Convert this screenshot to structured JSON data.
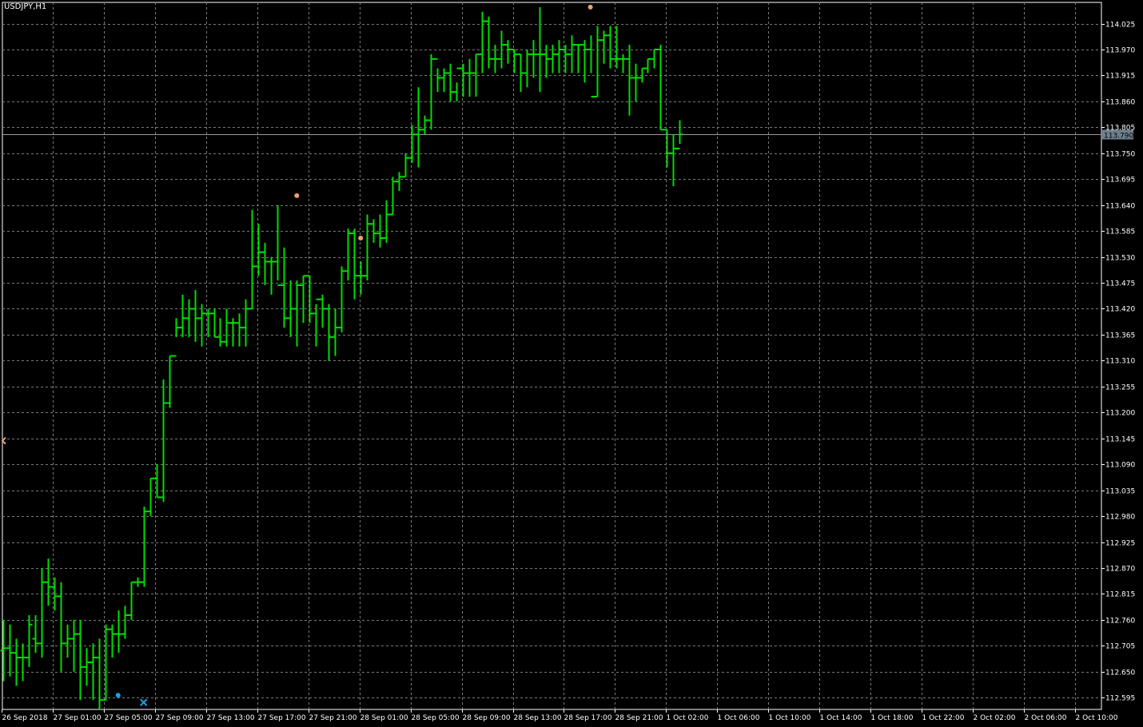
{
  "window": {
    "symbol_title": "USDJPY,H1"
  },
  "colors": {
    "background": "#000000",
    "grid": "#7a7a7a",
    "bars": "#00dd00",
    "text": "#ffffff",
    "current_price_box": "#6e7f8c",
    "dot_orange": "#f0a070",
    "dot_blue": "#1aa3e8"
  },
  "chart_data": {
    "type": "ohlc",
    "timeframe": "H1",
    "ylim": [
      112.57,
      114.07
    ],
    "grid": true,
    "current_price": {
      "value": 113.79,
      "label": "113.790"
    },
    "y_ticks": [
      "114.025",
      "113.970",
      "113.915",
      "113.860",
      "113.805",
      "113.750",
      "113.695",
      "113.640",
      "113.585",
      "113.530",
      "113.475",
      "113.420",
      "113.365",
      "113.310",
      "113.255",
      "113.200",
      "113.145",
      "113.090",
      "113.035",
      "112.980",
      "112.925",
      "112.870",
      "112.815",
      "112.760",
      "112.705",
      "112.650",
      "112.595"
    ],
    "x_ticks": [
      "26 Sep 2018",
      "27 Sep 01:00",
      "27 Sep 05:00",
      "27 Sep 09:00",
      "27 Sep 13:00",
      "27 Sep 17:00",
      "27 Sep 21:00",
      "28 Sep 01:00",
      "28 Sep 05:00",
      "28 Sep 09:00",
      "28 Sep 13:00",
      "28 Sep 17:00",
      "28 Sep 21:00",
      "1 Oct 02:00",
      "1 Oct 06:00",
      "1 Oct 10:00",
      "1 Oct 14:00",
      "1 Oct 18:00",
      "1 Oct 22:00",
      "2 Oct 02:00",
      "2 Oct 06:00",
      "2 Oct 10:00"
    ],
    "bars": [
      [
        112.695,
        112.76,
        112.63,
        112.7
      ],
      [
        112.7,
        112.75,
        112.64,
        112.69
      ],
      [
        112.69,
        112.72,
        112.62,
        112.68
      ],
      [
        112.68,
        112.71,
        112.63,
        112.68
      ],
      [
        112.68,
        112.77,
        112.66,
        112.75
      ],
      [
        112.72,
        112.77,
        112.69,
        112.71
      ],
      [
        112.71,
        112.87,
        112.68,
        112.84
      ],
      [
        112.84,
        112.89,
        112.79,
        112.83
      ],
      [
        112.83,
        112.85,
        112.78,
        112.81
      ],
      [
        112.81,
        112.84,
        112.65,
        112.71
      ],
      [
        112.71,
        112.75,
        112.68,
        112.72
      ],
      [
        112.72,
        112.76,
        112.65,
        112.73
      ],
      [
        112.73,
        112.76,
        112.59,
        112.66
      ],
      [
        112.66,
        112.7,
        112.62,
        112.67
      ],
      [
        112.67,
        112.71,
        112.59,
        112.68
      ],
      [
        112.68,
        112.72,
        112.57,
        112.59
      ],
      [
        112.59,
        112.75,
        112.59,
        112.74
      ],
      [
        112.74,
        112.75,
        112.68,
        112.73
      ],
      [
        112.73,
        112.78,
        112.69,
        112.73
      ],
      [
        112.73,
        112.79,
        112.72,
        112.77
      ],
      [
        112.77,
        112.84,
        112.76,
        112.84
      ],
      [
        112.84,
        112.85,
        112.83,
        112.84
      ],
      [
        112.84,
        113.0,
        112.83,
        112.99
      ],
      [
        112.99,
        113.06,
        112.98,
        113.06
      ],
      [
        113.06,
        113.09,
        113.02,
        113.02
      ],
      [
        113.02,
        113.27,
        113.01,
        113.22
      ],
      [
        113.22,
        113.32,
        113.21,
        113.32
      ],
      [
        113.32,
        113.4,
        113.36,
        113.38
      ],
      [
        113.38,
        113.45,
        113.36,
        113.4
      ],
      [
        113.4,
        113.44,
        113.36,
        113.42
      ],
      [
        113.42,
        113.46,
        113.35,
        113.4
      ],
      [
        113.4,
        113.43,
        113.34,
        113.41
      ],
      [
        113.41,
        113.42,
        113.36,
        113.41
      ],
      [
        113.41,
        113.42,
        113.36,
        113.36
      ],
      [
        113.36,
        113.4,
        113.34,
        113.35
      ],
      [
        113.35,
        113.42,
        113.34,
        113.39
      ],
      [
        113.39,
        113.4,
        113.34,
        113.39
      ],
      [
        113.39,
        113.41,
        113.34,
        113.38
      ],
      [
        113.38,
        113.44,
        113.34,
        113.42
      ],
      [
        113.42,
        113.63,
        113.42,
        113.51
      ],
      [
        113.51,
        113.6,
        113.49,
        113.54
      ],
      [
        113.54,
        113.56,
        113.47,
        113.52
      ],
      [
        113.52,
        113.53,
        113.45,
        113.52
      ],
      [
        113.52,
        113.64,
        113.48,
        113.47
      ],
      [
        113.47,
        113.55,
        113.38,
        113.4
      ],
      [
        113.4,
        113.48,
        113.36,
        113.42
      ],
      [
        113.42,
        113.48,
        113.34,
        113.47
      ],
      [
        113.47,
        113.49,
        113.39,
        113.49
      ],
      [
        113.49,
        113.49,
        113.39,
        113.41
      ],
      [
        113.41,
        113.43,
        113.34,
        113.44
      ],
      [
        113.44,
        113.45,
        113.38,
        113.42
      ],
      [
        113.42,
        113.43,
        113.31,
        113.36
      ],
      [
        113.36,
        113.42,
        113.32,
        113.38
      ],
      [
        113.38,
        113.51,
        113.37,
        113.5
      ],
      [
        113.5,
        113.59,
        113.48,
        113.58
      ],
      [
        113.58,
        113.59,
        113.44,
        113.49
      ],
      [
        113.49,
        113.52,
        113.45,
        113.49
      ],
      [
        113.49,
        113.62,
        113.48,
        113.6
      ],
      [
        113.6,
        113.61,
        113.56,
        113.58
      ],
      [
        113.58,
        113.62,
        113.55,
        113.57
      ],
      [
        113.57,
        113.65,
        113.56,
        113.62
      ],
      [
        113.62,
        113.7,
        113.62,
        113.69
      ],
      [
        113.69,
        113.71,
        113.67,
        113.7
      ],
      [
        113.7,
        113.75,
        113.7,
        113.74
      ],
      [
        113.74,
        113.81,
        113.73,
        113.79
      ],
      [
        113.79,
        113.89,
        113.72,
        113.8
      ],
      [
        113.8,
        113.83,
        113.79,
        113.82
      ],
      [
        113.82,
        113.96,
        113.8,
        113.95
      ],
      [
        113.95,
        113.93,
        113.88,
        113.91
      ],
      [
        113.91,
        113.93,
        113.88,
        113.92
      ],
      [
        113.92,
        113.94,
        113.86,
        113.88
      ],
      [
        113.88,
        113.9,
        113.86,
        113.93
      ],
      [
        113.93,
        113.94,
        113.87,
        113.92
      ],
      [
        113.92,
        113.95,
        113.87,
        113.92
      ],
      [
        113.92,
        113.96,
        113.87,
        113.96
      ],
      [
        113.96,
        114.05,
        113.92,
        114.03
      ],
      [
        114.03,
        114.04,
        113.93,
        113.95
      ],
      [
        113.95,
        113.98,
        113.92,
        113.95
      ],
      [
        113.95,
        114.01,
        113.93,
        113.98
      ],
      [
        113.98,
        113.99,
        113.94,
        113.97
      ],
      [
        113.97,
        113.97,
        113.92,
        113.96
      ],
      [
        113.96,
        113.96,
        113.88,
        113.92
      ],
      [
        113.92,
        113.97,
        113.89,
        113.96
      ],
      [
        113.96,
        113.99,
        113.91,
        113.96
      ],
      [
        113.96,
        114.06,
        113.88,
        113.96
      ],
      [
        113.96,
        113.98,
        113.91,
        113.95
      ],
      [
        113.95,
        113.98,
        113.92,
        113.96
      ],
      [
        113.96,
        113.99,
        113.92,
        113.97
      ],
      [
        113.97,
        113.98,
        113.92,
        113.96
      ],
      [
        113.96,
        114.0,
        113.92,
        113.98
      ],
      [
        113.98,
        113.98,
        113.92,
        113.98
      ],
      [
        113.98,
        113.99,
        113.9,
        113.97
      ],
      [
        113.97,
        114.0,
        113.92,
        113.87
      ],
      [
        113.87,
        114.02,
        113.87,
        113.99
      ],
      [
        113.99,
        114.01,
        113.94,
        114.0
      ],
      [
        114.0,
        114.02,
        113.93,
        113.95
      ],
      [
        113.95,
        114.02,
        113.93,
        113.95
      ],
      [
        113.95,
        113.96,
        113.92,
        113.95
      ],
      [
        113.95,
        113.98,
        113.83,
        113.91
      ],
      [
        113.91,
        113.94,
        113.86,
        113.91
      ],
      [
        113.91,
        113.93,
        113.9,
        113.93
      ],
      [
        113.93,
        113.95,
        113.92,
        113.95
      ],
      [
        113.95,
        113.97,
        113.93,
        113.97
      ],
      [
        113.97,
        113.98,
        113.8,
        113.8
      ],
      [
        113.8,
        113.8,
        113.72,
        113.75
      ],
      [
        113.75,
        113.79,
        113.68,
        113.76
      ],
      [
        113.76,
        113.82,
        113.77,
        113.79
      ]
    ],
    "markers": [
      {
        "type": "dot",
        "color": "orange",
        "bar": 46,
        "price": 113.66
      },
      {
        "type": "dot",
        "color": "orange",
        "bar": 56,
        "price": 113.57
      },
      {
        "type": "dot",
        "color": "orange",
        "bar": 92,
        "price": 114.06
      },
      {
        "type": "dot",
        "color": "blue",
        "bar": 18,
        "price": 112.6
      },
      {
        "type": "cross",
        "color": "blue",
        "bar": 22,
        "price": 112.585
      },
      {
        "type": "arrow-left",
        "color": "orange",
        "bar": 0,
        "price": 113.14
      }
    ]
  }
}
